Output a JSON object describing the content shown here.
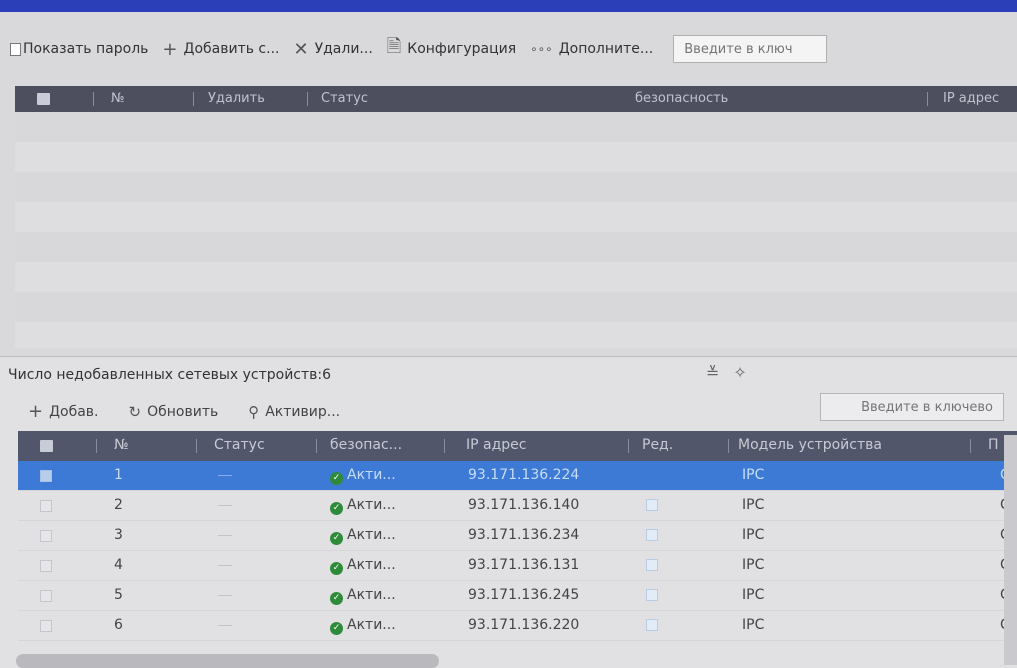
{
  "toolbar": {
    "show_password": "Показать пароль",
    "add": "Добавить с...",
    "delete": "Удали...",
    "config": "Конфигурация",
    "more": "Дополните...",
    "search_placeholder": "Введите в ключ"
  },
  "added_table": {
    "columns": [
      "№",
      "Удалить",
      "Статус",
      "безопасность",
      "IP адрес"
    ]
  },
  "unadded": {
    "title": "Число недобавленных сетевых устройств:6",
    "add": "Добав.",
    "refresh": "Обновить",
    "activate": "Активир...",
    "search_placeholder": "Введите в ключево",
    "columns": [
      "№",
      "Статус",
      "безопас...",
      "IP адрес",
      "Ред.",
      "Модель устройства",
      "П"
    ],
    "rows": [
      {
        "num": "1",
        "security": "Акти...",
        "ip": "93.171.136.224",
        "model": "IPC",
        "extra": "C",
        "selected": true
      },
      {
        "num": "2",
        "security": "Акти...",
        "ip": "93.171.136.140",
        "model": "IPC",
        "extra": "C",
        "selected": false
      },
      {
        "num": "3",
        "security": "Акти...",
        "ip": "93.171.136.234",
        "model": "IPC",
        "extra": "C",
        "selected": false
      },
      {
        "num": "4",
        "security": "Акти...",
        "ip": "93.171.136.131",
        "model": "IPC",
        "extra": "C",
        "selected": false
      },
      {
        "num": "5",
        "security": "Акти...",
        "ip": "93.171.136.245",
        "model": "IPC",
        "extra": "C",
        "selected": false
      },
      {
        "num": "6",
        "security": "Акти...",
        "ip": "93.171.136.220",
        "model": "IPC",
        "extra": "C",
        "selected": false
      }
    ]
  }
}
